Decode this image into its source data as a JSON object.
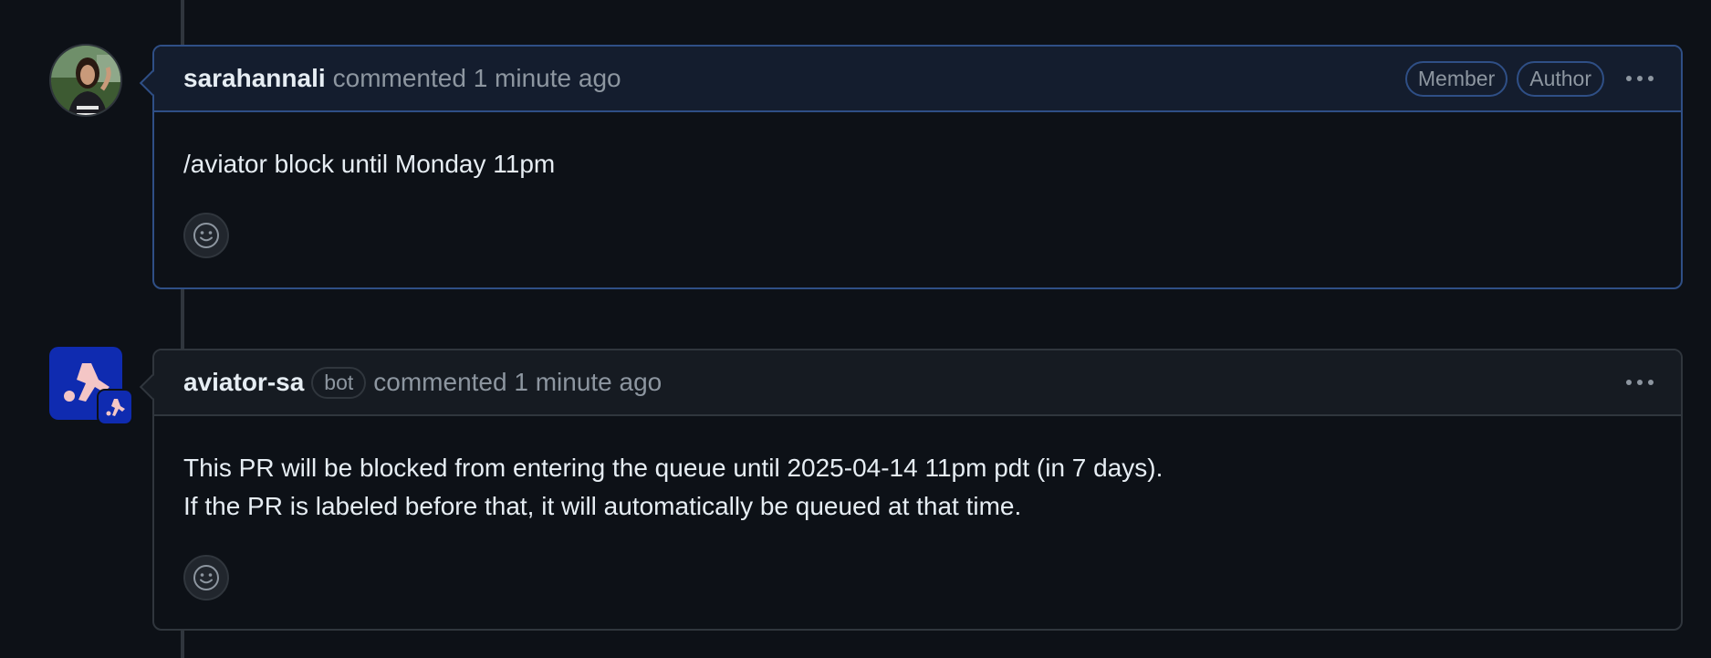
{
  "comments": [
    {
      "author": "sarahannali",
      "action": "commented 1 minute ago",
      "labels": [
        "Member",
        "Author"
      ],
      "body": [
        "/aviator block until Monday 11pm"
      ]
    },
    {
      "author": "aviator-sa",
      "bot_label": "bot",
      "action": "commented 1 minute ago",
      "body": [
        "This PR will be blocked from entering the queue until 2025-04-14 11pm pdt (in 7 days).",
        "If the PR is labeled before that, it will automatically be queued at that time."
      ]
    }
  ],
  "icons": {
    "more": "kebab-horizontal-icon",
    "reaction": "smiley-icon"
  },
  "colors": {
    "background": "#0d1117",
    "border": "#30363d",
    "highlight_border": "#2f4f86",
    "muted_text": "#8d96a0",
    "bot_avatar": "#0f2bb0"
  }
}
